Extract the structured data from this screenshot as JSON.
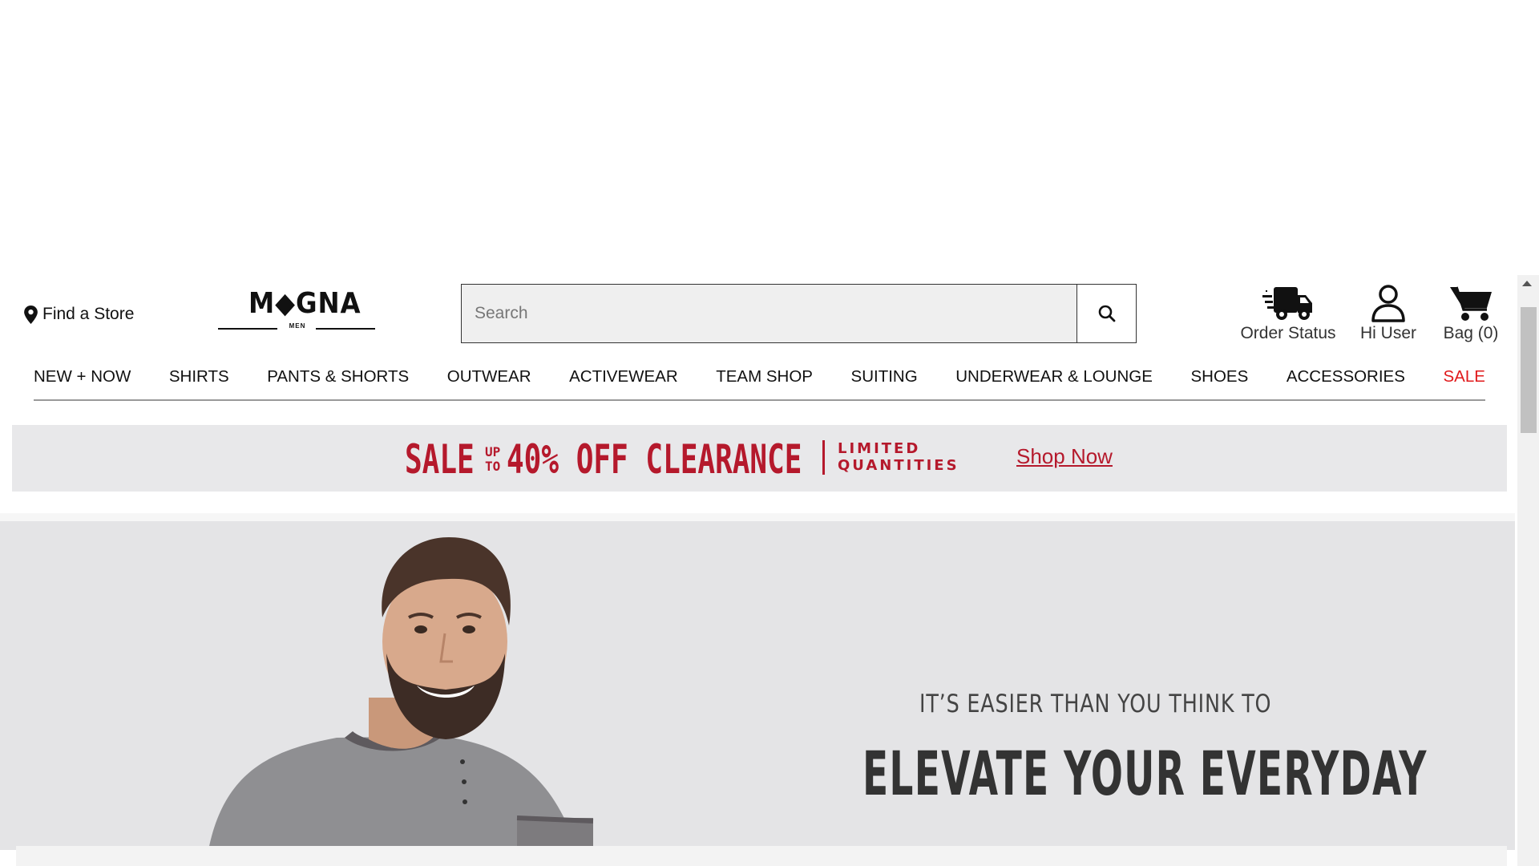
{
  "header": {
    "find_store": "Find a Store",
    "logo_word": "M◆GNA",
    "logo_sub": "MEN",
    "search_placeholder": "Search",
    "order_status": "Order Status",
    "user_greeting": "Hi User",
    "bag_label": "Bag (0)"
  },
  "nav": {
    "items": [
      "NEW + NOW",
      "SHIRTS",
      "PANTS & SHORTS",
      "OUTWEAR",
      "ACTIVEWEAR",
      "TEAM SHOP",
      "SUITING",
      "UNDERWEAR & LOUNGE",
      "SHOES",
      "ACCESSORIES",
      "SALE"
    ]
  },
  "promo": {
    "sale_word": "SALE",
    "up": "UP",
    "to": "TO",
    "headline": "40% OFF CLEARANCE",
    "limited_line1": "LIMITED",
    "limited_line2": "QUANTITIES",
    "shop_now": "Shop Now"
  },
  "hero": {
    "eyebrow": "IT’S EASIER THAN YOU THINK TO",
    "title": "ELEVATE YOUR EVERYDAY"
  },
  "colors": {
    "accent_red": "#b5192c",
    "sale_red": "#e0191b",
    "hero_bg": "#e4e4e6",
    "promo_bg": "#e8e8ea"
  }
}
